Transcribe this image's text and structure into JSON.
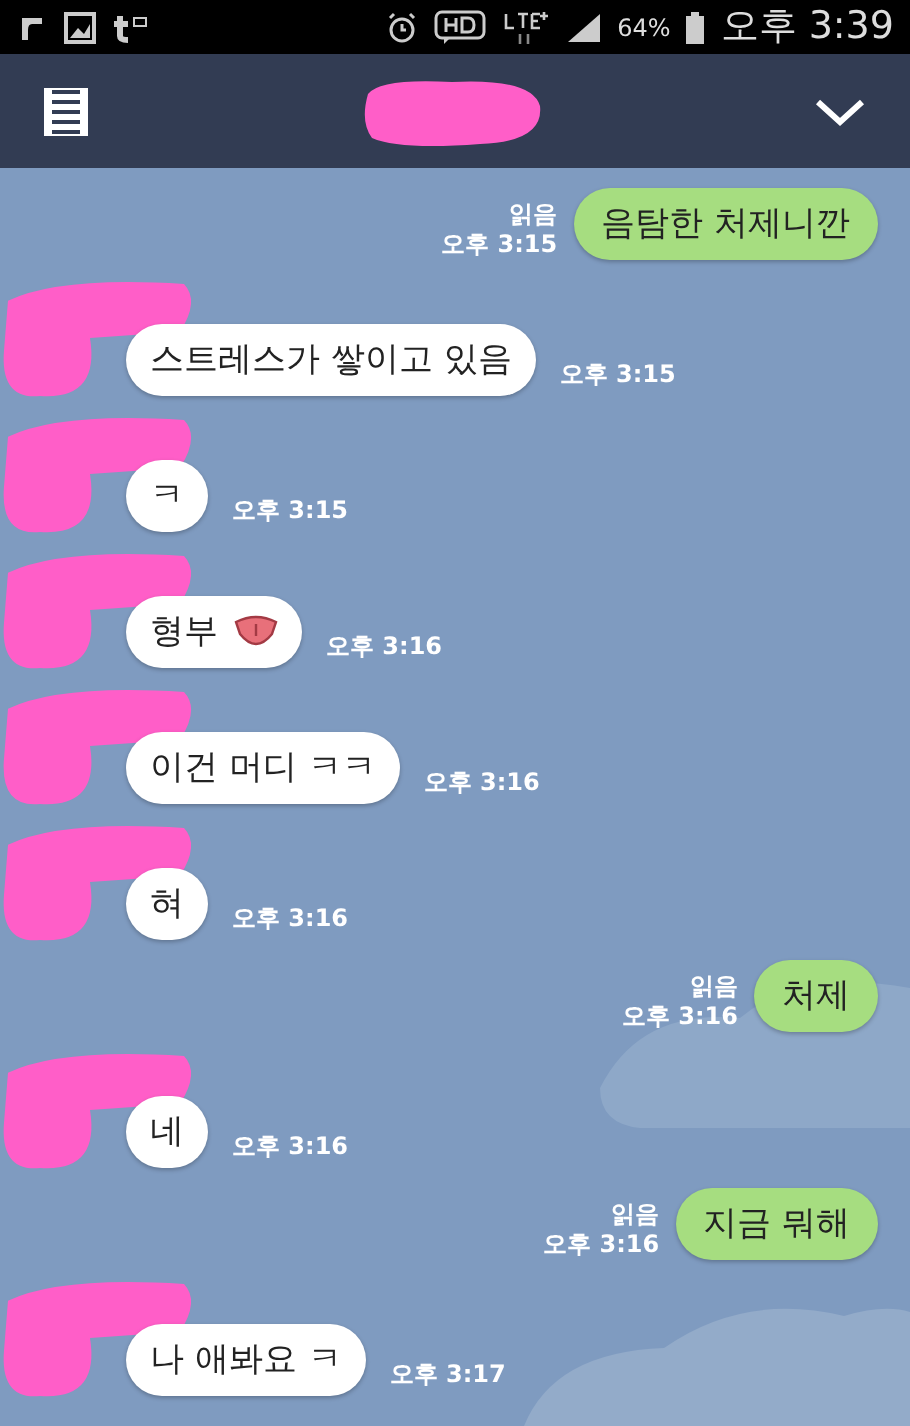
{
  "status_bar": {
    "battery": "64%",
    "time": "오후 3:39"
  },
  "header": {
    "title_redacted": true
  },
  "messages": [
    {
      "kind": "sent",
      "text": "음탐한 처제니깐",
      "read": "읽음",
      "time": "오후 3:15"
    },
    {
      "kind": "received",
      "text": "스트레스가 쌓이고 있음",
      "time": "오후 3:15",
      "has_emoticon": false
    },
    {
      "kind": "received",
      "text": "ㅋ",
      "time": "오후 3:15",
      "has_emoticon": false
    },
    {
      "kind": "received",
      "text": "형부",
      "time": "오후 3:16",
      "has_emoticon": true
    },
    {
      "kind": "received",
      "text": "이건 머디 ㅋㅋ",
      "time": "오후 3:16",
      "has_emoticon": false
    },
    {
      "kind": "received",
      "text": "혀",
      "time": "오후 3:16",
      "has_emoticon": false
    },
    {
      "kind": "sent",
      "text": "처제",
      "read": "읽음",
      "time": "오후 3:16"
    },
    {
      "kind": "received",
      "text": "네",
      "time": "오후 3:16",
      "has_emoticon": false
    },
    {
      "kind": "sent",
      "text": "지금 뭐해",
      "read": "읽음",
      "time": "오후 3:16"
    },
    {
      "kind": "received",
      "text": "나 애봐요 ㅋ",
      "time": "오후 3:17",
      "has_emoticon": false
    }
  ]
}
